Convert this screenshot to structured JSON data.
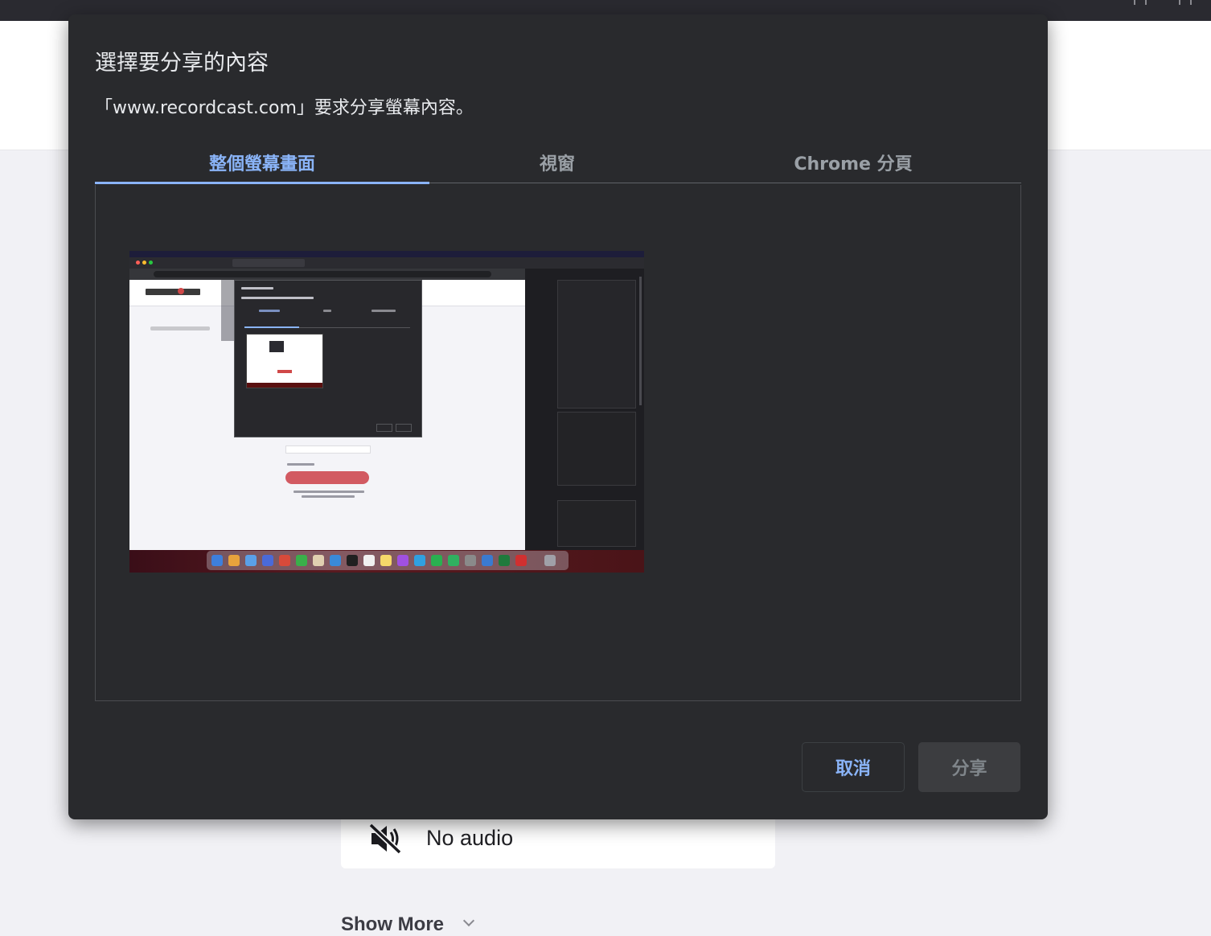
{
  "dialog": {
    "title": "選擇要分享的內容",
    "subtitle": "「www.recordcast.com」要求分享螢幕內容。",
    "tabs": [
      {
        "label": "整個螢幕畫面",
        "active": true
      },
      {
        "label": "視窗",
        "active": false
      },
      {
        "label": "Chrome 分頁",
        "active": false
      }
    ],
    "buttons": {
      "cancel": "取消",
      "share": "分享"
    }
  },
  "background": {
    "audio_option": "No audio",
    "audio_icon": "speaker-muted-icon",
    "show_more": "Show More"
  },
  "colors": {
    "dialog_bg": "#292a2d",
    "accent": "#8ab4f8",
    "page_bg": "#f1f1f5"
  }
}
